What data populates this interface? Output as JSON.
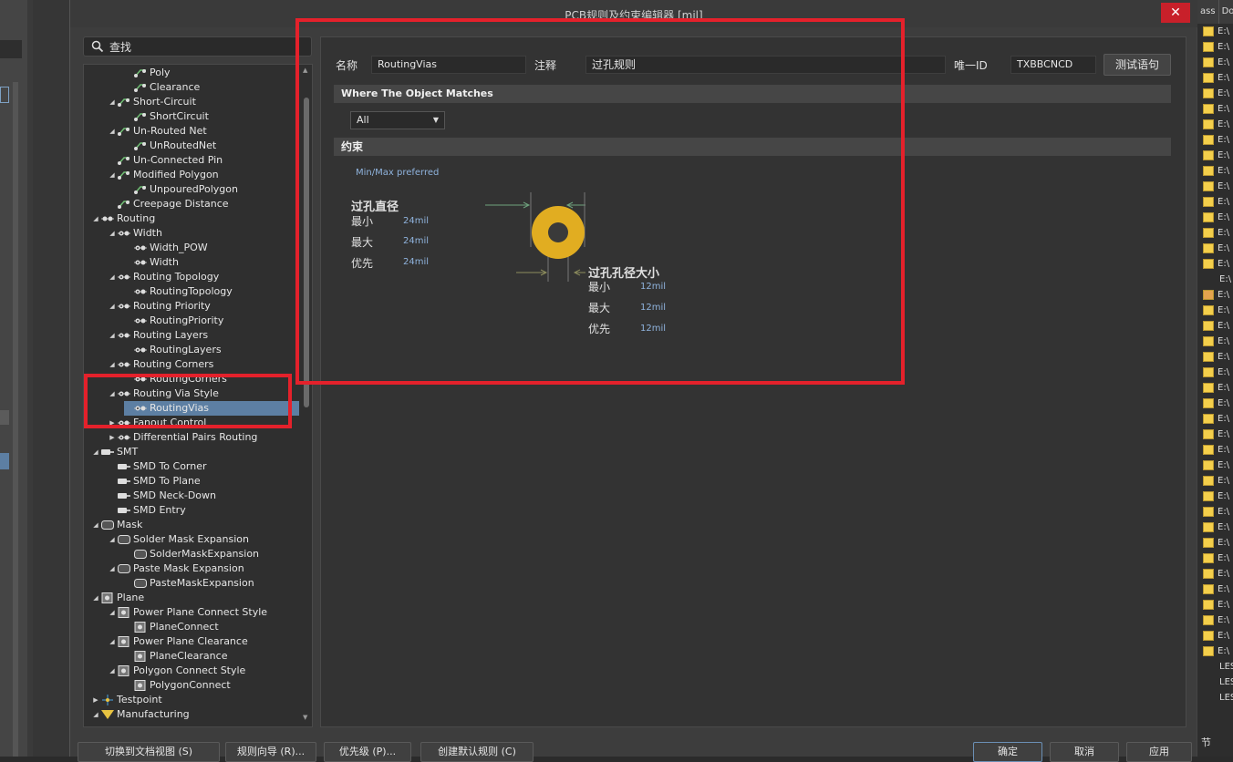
{
  "dialog": {
    "title": "PCB规则及约束编辑器 [mil]",
    "close_label": "✕"
  },
  "search": {
    "placeholder": "查找"
  },
  "tree": {
    "items": [
      {
        "label": "Poly",
        "level": 3
      },
      {
        "label": "Clearance",
        "level": 3
      },
      {
        "label": "Short-Circuit",
        "level": 2
      },
      {
        "label": "ShortCircuit",
        "level": 3
      },
      {
        "label": "Un-Routed Net",
        "level": 2
      },
      {
        "label": "UnRoutedNet",
        "level": 3
      },
      {
        "label": "Un-Connected Pin",
        "level": 2
      },
      {
        "label": "Modified Polygon",
        "level": 2
      },
      {
        "label": "UnpouredPolygon",
        "level": 3
      },
      {
        "label": "Creepage Distance",
        "level": 2
      },
      {
        "label": "Routing",
        "level": 1
      },
      {
        "label": "Width",
        "level": 2
      },
      {
        "label": "Width_POW",
        "level": 3
      },
      {
        "label": "Width",
        "level": 3
      },
      {
        "label": "Routing Topology",
        "level": 2
      },
      {
        "label": "RoutingTopology",
        "level": 3
      },
      {
        "label": "Routing Priority",
        "level": 2
      },
      {
        "label": "RoutingPriority",
        "level": 3
      },
      {
        "label": "Routing Layers",
        "level": 2
      },
      {
        "label": "RoutingLayers",
        "level": 3
      },
      {
        "label": "Routing Corners",
        "level": 2
      },
      {
        "label": "RoutingCorners",
        "level": 3
      },
      {
        "label": "Routing Via Style",
        "level": 2
      },
      {
        "label": "RoutingVias",
        "level": 3,
        "selected": true
      },
      {
        "label": "Fanout Control",
        "level": 2
      },
      {
        "label": "Differential Pairs Routing",
        "level": 2
      },
      {
        "label": "SMT",
        "level": 1
      },
      {
        "label": "SMD To Corner",
        "level": 2
      },
      {
        "label": "SMD To Plane",
        "level": 2
      },
      {
        "label": "SMD Neck-Down",
        "level": 2
      },
      {
        "label": "SMD Entry",
        "level": 2
      },
      {
        "label": "Mask",
        "level": 1
      },
      {
        "label": "Solder Mask Expansion",
        "level": 2
      },
      {
        "label": "SolderMaskExpansion",
        "level": 3
      },
      {
        "label": "Paste Mask Expansion",
        "level": 2
      },
      {
        "label": "PasteMaskExpansion",
        "level": 3
      },
      {
        "label": "Plane",
        "level": 1
      },
      {
        "label": "Power Plane Connect Style",
        "level": 2
      },
      {
        "label": "PlaneConnect",
        "level": 3
      },
      {
        "label": "Power Plane Clearance",
        "level": 2
      },
      {
        "label": "PlaneClearance",
        "level": 3
      },
      {
        "label": "Polygon Connect Style",
        "level": 2
      },
      {
        "label": "PolygonConnect",
        "level": 3
      },
      {
        "label": "Testpoint",
        "level": 1
      },
      {
        "label": "Manufacturing",
        "level": 1
      }
    ]
  },
  "rule": {
    "name_label": "名称",
    "name_value": "RoutingVias",
    "comment_label": "注释",
    "comment_value": "过孔规则",
    "uid_label": "唯一ID",
    "uid_value": "TXBBCNCD",
    "test_button": "测试语句",
    "where_header": "Where The Object Matches",
    "match_option": "All",
    "constraints_header": "约束",
    "mode_label": "Min/Max preferred",
    "via_diameter_title": "过孔直径",
    "via_hole_title": "过孔孔径大小",
    "min_label": "最小",
    "max_label": "最大",
    "pref_label": "优先",
    "dia_min": "24mil",
    "dia_max": "24mil",
    "dia_pref": "24mil",
    "hole_min": "12mil",
    "hole_max": "12mil",
    "hole_pref": "12mil",
    "via_color": "#e1ad21"
  },
  "footer": {
    "switch_view": "切换到文档视图 (S)",
    "rule_wizard": "规则向导 (R)...",
    "priorities": "优先级 (P)...",
    "create_default": "创建默认规则 (C)",
    "ok": "确定",
    "cancel": "取消",
    "apply": "应用"
  },
  "right_panel": {
    "col1": "ass",
    "col2": "Do",
    "rows": [
      "E:\\",
      "E:\\",
      "E:\\",
      "E:\\",
      "E:\\",
      "E:\\",
      "E:\\",
      "E:\\",
      "E:\\",
      "E:\\",
      "E:\\",
      "E:\\",
      "E:\\",
      "E:\\",
      "E:\\",
      "E:\\",
      "E:\\",
      "E:\\",
      "E:\\",
      "E:\\",
      "E:\\",
      "E:\\",
      "E:\\",
      "E:\\",
      "E:\\",
      "E:\\",
      "E:\\",
      "E:\\",
      "E:\\",
      "E:\\",
      "E:\\",
      "E:\\",
      "E:\\",
      "E:\\",
      "E:\\",
      "E:\\",
      "E:\\",
      "E:\\",
      "E:\\",
      "E:\\",
      "E:\\",
      "LES",
      "LES",
      "LES"
    ],
    "footer": "节"
  }
}
